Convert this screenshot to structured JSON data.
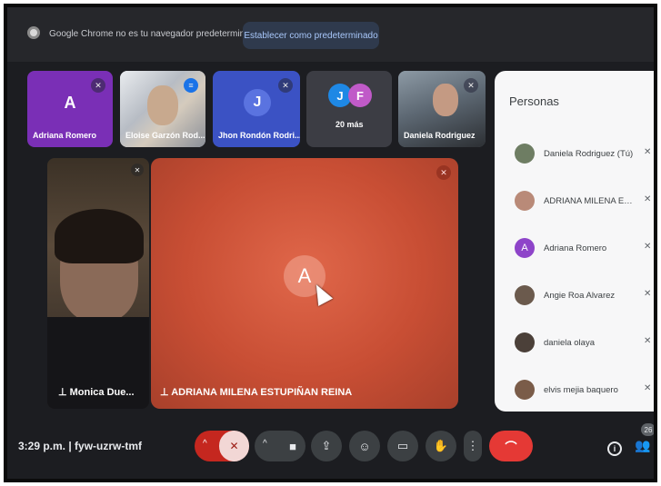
{
  "notice": {
    "text": "Google Chrome no es tu navegador predeterminado",
    "button": "Establecer como predeterminado"
  },
  "thumbnails": [
    {
      "name": "Adriana Romero",
      "initial": "A",
      "color": "#7a2fb6"
    },
    {
      "name": "Eloise Garzón Rod...",
      "color": "#c9cdd3"
    },
    {
      "name": "Jhon Rondón Rodri...",
      "initial": "J",
      "color": "#3b52c4"
    },
    {
      "more_label": "20 más",
      "initials": [
        "J",
        "F"
      ]
    },
    {
      "name": "Daniela Rodriguez"
    }
  ],
  "side_tile": {
    "name": "Monica Due..."
  },
  "main_tile": {
    "name": "ADRIANA MILENA ESTUPIÑAN REINA",
    "initial": "A"
  },
  "people_panel": {
    "title": "Personas",
    "people": [
      {
        "name": "Daniela Rodriguez (Tú)"
      },
      {
        "name": "ADRIANA MILENA ESTU..."
      },
      {
        "name": "Adriana Romero",
        "initial": "A"
      },
      {
        "name": "Angie Roa Alvarez"
      },
      {
        "name": "daniela olaya"
      },
      {
        "name": "elvis mejia baquero"
      }
    ]
  },
  "bottom_bar": {
    "time_code": "3:29 p.m.  |  fyw-uzrw-tmf",
    "people_count": "26"
  },
  "colors": {
    "main_tile": "#c84e34",
    "hangup": "#e53935",
    "accent": "#a8c7fa"
  }
}
